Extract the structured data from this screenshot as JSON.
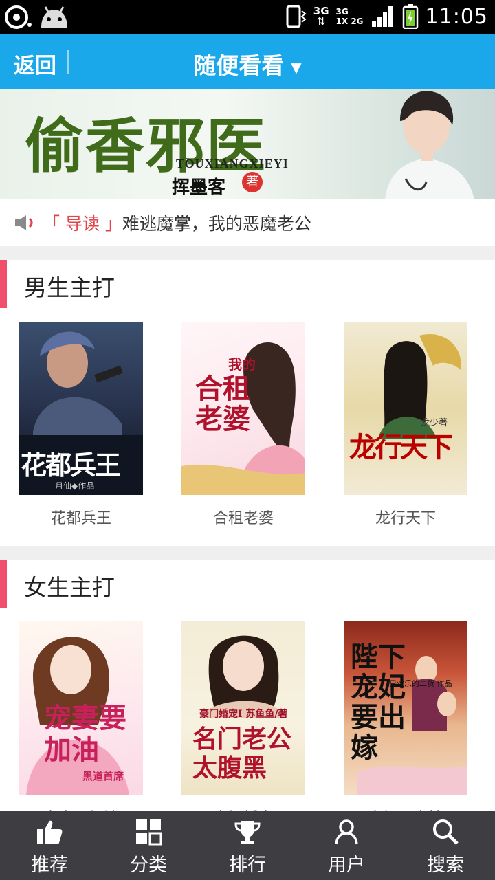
{
  "status_bar": {
    "time": "11:05",
    "network_top": "3G",
    "network_signal_a": "3G",
    "network_signal_b": "1X",
    "network_signal_c": "2G"
  },
  "header": {
    "back_label": "返回",
    "title": "随便看看",
    "title_caret": "▼"
  },
  "banner": {
    "title": "偷香邪医",
    "pinyin": "TOUXIANGXIEYI",
    "author": "挥墨客",
    "seal": "著"
  },
  "notice": {
    "tag": "「 导读 」",
    "text": "难逃魔掌，我的恶魔老公"
  },
  "sections": [
    {
      "title": "男生主打",
      "books": [
        {
          "title": "花都兵王",
          "cover_text": "花都兵王",
          "cover_sub": "月仙◆作品"
        },
        {
          "title": "合租老婆",
          "cover_text": "合租老婆",
          "cover_sub": "我的"
        },
        {
          "title": "龙行天下",
          "cover_text": "龙行天下",
          "cover_sub": "龙少著"
        }
      ]
    },
    {
      "title": "女生主打",
      "books": [
        {
          "title": "宠妻要加油",
          "cover_text": "宠妻要加油",
          "cover_sub": "黑道首席"
        },
        {
          "title": "豪门婚宠",
          "cover_text": "名门老公太腹黑",
          "cover_sub": "豪门婚宠Ⅰ 苏鱼鱼/著"
        },
        {
          "title": "宠妃要出嫁",
          "cover_text": "陛下宠妃要出嫁",
          "cover_sub": "只欢乐的二货 作品"
        }
      ]
    }
  ],
  "tabs": [
    {
      "label": "推荐",
      "icon": "thumbs-up-icon"
    },
    {
      "label": "分类",
      "icon": "grid-icon"
    },
    {
      "label": "排行",
      "icon": "trophy-icon"
    },
    {
      "label": "用户",
      "icon": "user-icon"
    },
    {
      "label": "搜索",
      "icon": "search-icon"
    }
  ],
  "colors": {
    "header_bg": "#1aa8ea",
    "section_accent": "#ef4f6a",
    "notice_tag": "#e0454b",
    "tabbar_bg": "#3e3e42"
  }
}
